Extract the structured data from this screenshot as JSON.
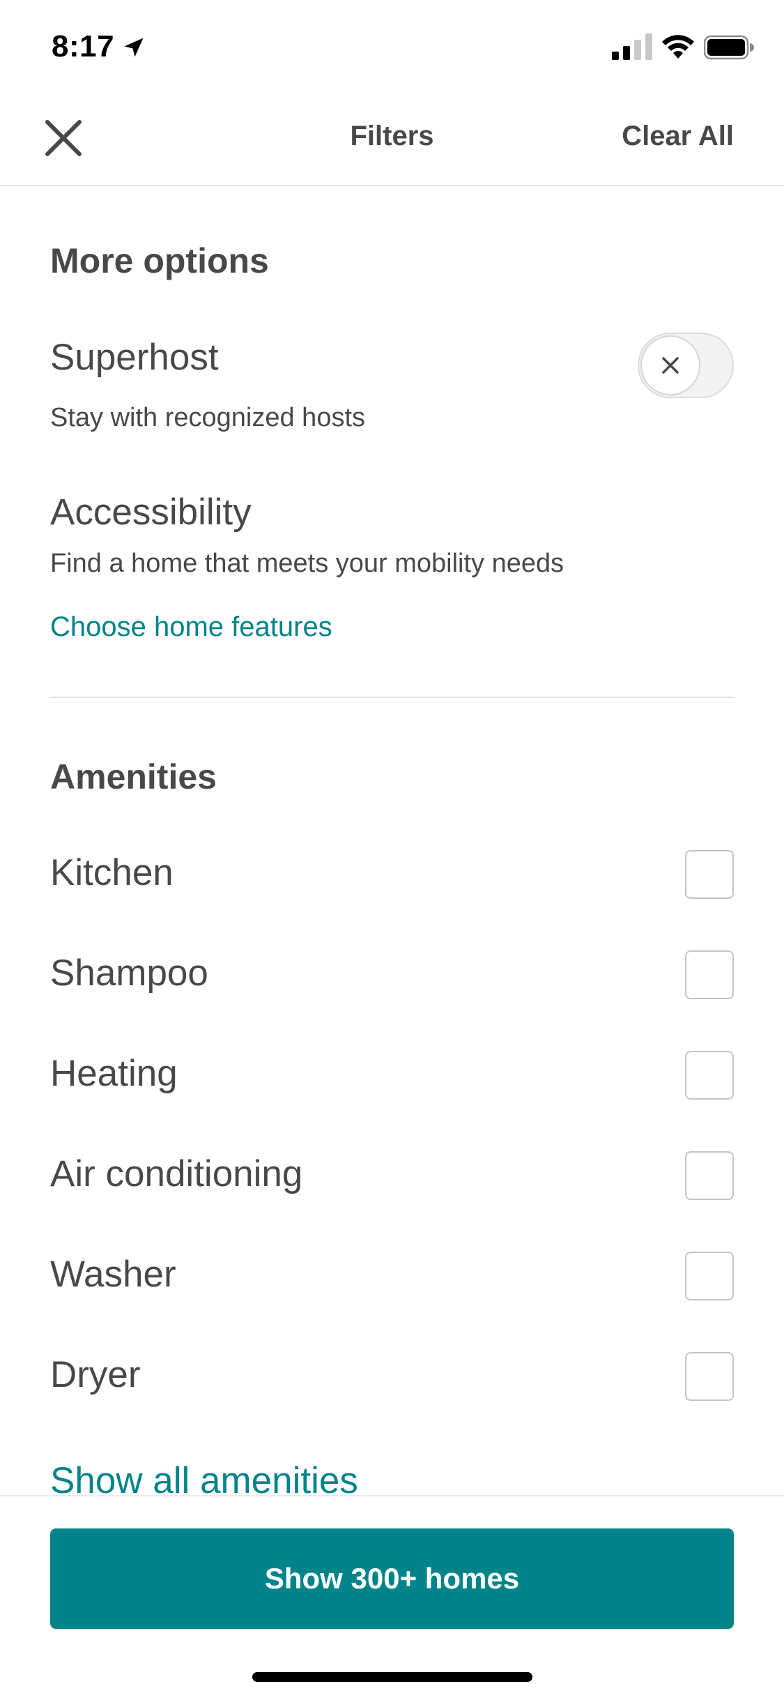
{
  "status_bar": {
    "time": "8:17",
    "icons": [
      "location-arrow-icon",
      "cellular-signal-icon",
      "wifi-icon",
      "battery-icon"
    ]
  },
  "header": {
    "title": "Filters",
    "clear_all_label": "Clear All",
    "close_icon": "close-icon"
  },
  "more_options": {
    "title": "More options",
    "superhost": {
      "title": "Superhost",
      "subtitle": "Stay with recognized hosts",
      "enabled": false
    },
    "accessibility": {
      "title": "Accessibility",
      "subtitle": "Find a home that meets your mobility needs",
      "link": "Choose home features"
    }
  },
  "amenities": {
    "title": "Amenities",
    "items": [
      {
        "label": "Kitchen",
        "checked": false
      },
      {
        "label": "Shampoo",
        "checked": false
      },
      {
        "label": "Heating",
        "checked": false
      },
      {
        "label": "Air conditioning",
        "checked": false
      },
      {
        "label": "Washer",
        "checked": false
      },
      {
        "label": "Dryer",
        "checked": false
      }
    ],
    "show_all_label": "Show all amenities"
  },
  "footer": {
    "cta_label": "Show 300+ homes"
  },
  "colors": {
    "accent": "#008489",
    "text": "#484848",
    "divider": "#e4e4e4"
  }
}
